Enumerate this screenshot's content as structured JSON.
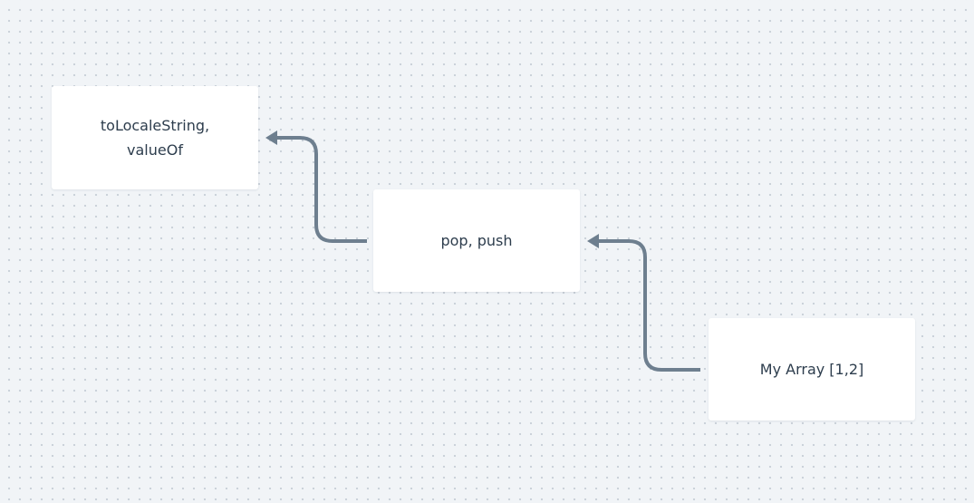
{
  "diagram": {
    "nodes": [
      {
        "id": "object-prototype",
        "label": "toLocaleString,\nvalueOf"
      },
      {
        "id": "array-prototype",
        "label": "pop, push"
      },
      {
        "id": "my-array",
        "label": "My Array [1,2]"
      }
    ],
    "edges": [
      {
        "from": "my-array",
        "to": "array-prototype"
      },
      {
        "from": "array-prototype",
        "to": "object-prototype"
      }
    ],
    "colors": {
      "background": "#f1f4f7",
      "grid_dot": "#c9d0d8",
      "node_fill": "#ffffff",
      "connector": "#6e7f8f",
      "text": "#2d3d4d"
    }
  }
}
